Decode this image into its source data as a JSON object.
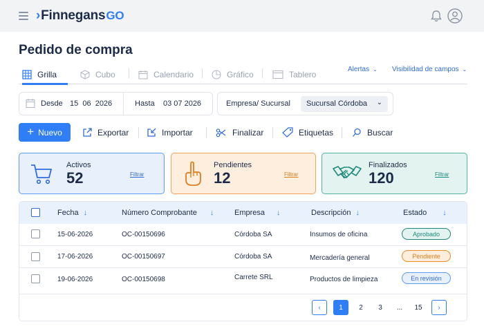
{
  "header": {
    "logo_text": "Finnegans",
    "logo_suffix": "GO",
    "brand_color": "#2f7ef6",
    "icons": [
      "menu-icon",
      "bell-icon",
      "user-icon"
    ]
  },
  "page_title": "Pedido de compra",
  "tabs": [
    {
      "label": "Grilla",
      "icon": "grid-icon",
      "active": true
    },
    {
      "label": "Cubo",
      "icon": "cube-icon",
      "active": false
    },
    {
      "label": "Calendario",
      "icon": "calendar-icon",
      "active": false
    },
    {
      "label": "Gráfico",
      "icon": "pie-chart-icon",
      "active": false
    },
    {
      "label": "Tablero",
      "icon": "board-icon",
      "active": false
    }
  ],
  "tab_links": {
    "alertas": "Alertas",
    "visibilidad": "Visibilidad de campos"
  },
  "filters": {
    "desde_label": "Desde",
    "desde_value": "15  06  2026",
    "hasta_label": "Hasta",
    "hasta_value": "03 07 2026",
    "empresa_label": "Empresa/ Sucursal",
    "sucursal_value": "Sucursal Córdoba"
  },
  "actions": {
    "nuevo": "Nuevo",
    "exportar": "Exportar",
    "importar": "Importar",
    "finalizar": "Finalizar",
    "etiquetas": "Etiquetas",
    "buscar": "Buscar"
  },
  "cards": [
    {
      "label": "Activos",
      "count": "52",
      "link": "Filtrar",
      "icon": "cart-icon",
      "color": "#2f7ef6"
    },
    {
      "label": "Pendientes",
      "count": "12",
      "link": "Filtrar",
      "icon": "hand-icon",
      "color": "#f08a24"
    },
    {
      "label": "Finalizados",
      "count": "120",
      "link": "Filtrar",
      "icon": "handshake-icon",
      "color": "#1f8a7a"
    }
  ],
  "table": {
    "columns": [
      "Fecha",
      "Número Comprobante",
      "Empresa",
      "Descripción",
      "Estado"
    ],
    "rows": [
      {
        "fecha": "15-06-2026",
        "numero": "OC-00150696",
        "empresa": "Córdoba SA",
        "descripcion": "Insumos de oficina",
        "estado": "Aprobado"
      },
      {
        "fecha": "17-06-2026",
        "numero": "OC-00150697",
        "empresa": "Córdoba SA",
        "descripcion": "Mercadería general",
        "estado": "Pendiente"
      },
      {
        "fecha": "19-06-2026",
        "numero": "OC-00150698",
        "empresa": "Carrete SRL",
        "descripcion": "Productos de limpieza",
        "estado": "En revisión"
      }
    ]
  },
  "pagination": {
    "pages": [
      "1",
      "2",
      "3",
      "...",
      "15"
    ],
    "current": "1",
    "prev": "‹",
    "next": "›"
  },
  "status_colors": {
    "aprobado": "#1f8a7a",
    "pendiente": "#f08a24",
    "revision": "#2f6bdc"
  }
}
